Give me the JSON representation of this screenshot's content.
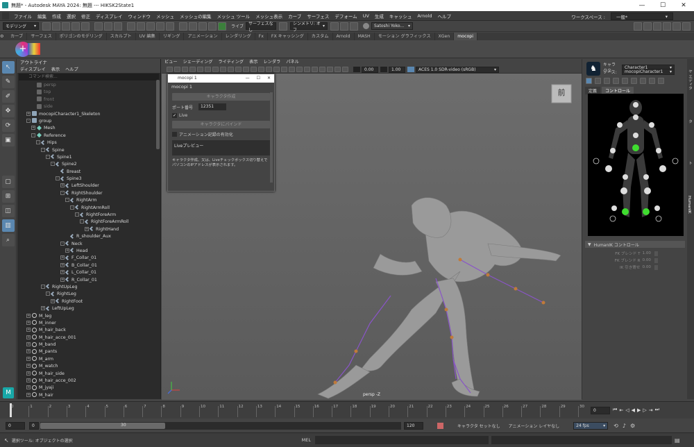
{
  "window": {
    "title": "無題* - Autodesk MAYA 2024: 無題   ---   HIKSK2State1",
    "min": "—",
    "max": "☐",
    "close": "✕"
  },
  "menu": [
    "ファイル",
    "編集",
    "作成",
    "選択",
    "修正",
    "ディスプレイ",
    "ウィンドウ",
    "メッシュ",
    "メッシュの編集",
    "メッシュ ツール",
    "メッシュ表示",
    "カーブ",
    "サーフェス",
    "デフォーム",
    "UV",
    "生成",
    "キャッシュ",
    "Arnold",
    "ヘルプ"
  ],
  "workspace": {
    "label": "ワークスペース :",
    "value": "一般*"
  },
  "status": {
    "mode": "モデリング",
    "symmetry_prefix": "ライブ",
    "live_surface": "サーフェスなし",
    "symmetry": "シンメトリ: オフ",
    "user": "Satoshi Yoko..."
  },
  "shelf_tabs": [
    "カーブ",
    "サーフェス",
    "ポリゴンのモデリング",
    "スカルプト",
    "UV 編集",
    "リギング",
    "アニメーション",
    "レンダリング",
    "Fx",
    "FX キャッシング",
    "カスタム",
    "Arnold",
    "MASH",
    "モーション グラフィックス",
    "XGen",
    "mocopi"
  ],
  "shelf_active": "mocopi",
  "outliner": {
    "title": "アウトライナ",
    "menu": [
      "ディスプレイ",
      "表示",
      "ヘルプ"
    ],
    "search_placeholder": "コマンド検索...",
    "rows": [
      {
        "d": 2,
        "t": "persp",
        "i": "cam",
        "dim": true
      },
      {
        "d": 2,
        "t": "top",
        "i": "cam",
        "dim": true
      },
      {
        "d": 2,
        "t": "front",
        "i": "cam",
        "dim": true
      },
      {
        "d": 2,
        "t": "side",
        "i": "cam",
        "dim": true
      },
      {
        "d": 1,
        "t": "mocopiCharacter1_Skeleton",
        "i": "grp",
        "e": "+"
      },
      {
        "d": 1,
        "t": "group",
        "i": "grp",
        "e": "-"
      },
      {
        "d": 2,
        "t": "Mesh",
        "i": "mesh",
        "e": "+"
      },
      {
        "d": 2,
        "t": "Reference",
        "i": "mesh",
        "e": "-"
      },
      {
        "d": 3,
        "t": "Hips",
        "i": "joint",
        "e": "-"
      },
      {
        "d": 4,
        "t": "Spine",
        "i": "joint",
        "e": "-"
      },
      {
        "d": 5,
        "t": "Spine1",
        "i": "joint",
        "e": "-"
      },
      {
        "d": 6,
        "t": "Spine2",
        "i": "joint",
        "e": "-"
      },
      {
        "d": 7,
        "t": "Breast",
        "i": "joint"
      },
      {
        "d": 7,
        "t": "Spine3",
        "i": "joint",
        "e": "-"
      },
      {
        "d": 8,
        "t": "LeftShoulder",
        "i": "joint",
        "e": "+"
      },
      {
        "d": 8,
        "t": "RightShoulder",
        "i": "joint",
        "e": "-"
      },
      {
        "d": 9,
        "t": "RightArm",
        "i": "joint",
        "e": "-"
      },
      {
        "d": 10,
        "t": "RightArmRoll",
        "i": "joint",
        "e": "-"
      },
      {
        "d": 11,
        "t": "RightForeArm",
        "i": "joint",
        "e": "-"
      },
      {
        "d": 12,
        "t": "RightForeArmRoll",
        "i": "joint",
        "e": "-"
      },
      {
        "d": 13,
        "t": "RightHand",
        "i": "joint",
        "e": "+"
      },
      {
        "d": 9,
        "t": "R_shoulder_Aux",
        "i": "joint"
      },
      {
        "d": 8,
        "t": "Neck",
        "i": "joint",
        "e": "-"
      },
      {
        "d": 9,
        "t": "Head",
        "i": "joint",
        "e": "+"
      },
      {
        "d": 8,
        "t": "F_Collar_01",
        "i": "joint",
        "e": "+"
      },
      {
        "d": 8,
        "t": "B_Collar_01",
        "i": "joint",
        "e": "+"
      },
      {
        "d": 8,
        "t": "L_Collar_01",
        "i": "joint",
        "e": "+"
      },
      {
        "d": 8,
        "t": "R_Collar_01",
        "i": "joint",
        "e": "+"
      },
      {
        "d": 4,
        "t": "RightUpLeg",
        "i": "joint",
        "e": "-"
      },
      {
        "d": 5,
        "t": "RightLeg",
        "i": "joint",
        "e": "-"
      },
      {
        "d": 6,
        "t": "RightFoot",
        "i": "joint",
        "e": "+"
      },
      {
        "d": 4,
        "t": "LeftUpLeg",
        "i": "joint",
        "e": "+"
      },
      {
        "d": 1,
        "t": "M_leg",
        "i": "loc",
        "e": "+"
      },
      {
        "d": 1,
        "t": "M_inner",
        "i": "loc",
        "e": "+"
      },
      {
        "d": 1,
        "t": "M_hair_back",
        "i": "loc",
        "e": "+"
      },
      {
        "d": 1,
        "t": "M_hair_acce_001",
        "i": "loc",
        "e": "+"
      },
      {
        "d": 1,
        "t": "M_band",
        "i": "loc",
        "e": "+"
      },
      {
        "d": 1,
        "t": "M_pants",
        "i": "loc",
        "e": "+"
      },
      {
        "d": 1,
        "t": "M_arm",
        "i": "loc",
        "e": "+"
      },
      {
        "d": 1,
        "t": "M_watch",
        "i": "loc",
        "e": "+"
      },
      {
        "d": 1,
        "t": "M_hair_side",
        "i": "loc",
        "e": "+"
      },
      {
        "d": 1,
        "t": "M_hair_acce_002",
        "i": "loc",
        "e": "+"
      },
      {
        "d": 1,
        "t": "M_jyaji",
        "i": "loc",
        "e": "+"
      },
      {
        "d": 1,
        "t": "M_hair",
        "i": "loc",
        "e": "+"
      }
    ]
  },
  "viewport": {
    "menu": [
      "ビュー",
      "シェーディング",
      "ライティング",
      "表示",
      "レンダラ",
      "パネル"
    ],
    "exposure": "0.00",
    "gamma": "1.00",
    "colorspace": "ACES 1.0 SDR-video (sRGB)",
    "camera_label": "persp -Z",
    "view_cube": "前"
  },
  "dialog": {
    "title": "mocopi 1",
    "heading": "mocopi 1",
    "create_char": "キャラクタ作成",
    "port_label": "ポート番号",
    "port": "12351",
    "live": "Live",
    "bind": "キャラクタにバインド",
    "anim_record": "アニメーション記録の有効化",
    "preview": "Liveプレビュー",
    "note": "キャラクタ作成、又は、Liveチェックボックス切り替えでパソコンのIPアドレスが表示されます。"
  },
  "hik": {
    "character_label": "キャラクタ:",
    "character": "Character1",
    "source_label": "ソース:",
    "source": "mocopiCharacter1",
    "tabs": [
      "定義",
      "コントロール"
    ],
    "active_tab": "コントロール",
    "section": "HumanIK コントロール",
    "params": [
      {
        "label": "FK ブレンド T",
        "value": "1.00"
      },
      {
        "label": "FK ブレンド R",
        "value": "0.00"
      },
      {
        "label": "IK 引き寄せ",
        "value": "0.00"
      }
    ]
  },
  "side_tabs": [
    "チャネル ボックス/レイヤ エディタ",
    "アトリビュート エディタ",
    "モデリング ツールキット",
    "HumanIK"
  ],
  "timeline": {
    "ticks": [
      "0",
      "1",
      "2",
      "3",
      "4",
      "5",
      "6",
      "7",
      "8",
      "9",
      "10",
      "11",
      "12",
      "13",
      "14",
      "15",
      "16",
      "17",
      "18",
      "19",
      "20",
      "21",
      "22",
      "23",
      "24",
      "25",
      "26",
      "27",
      "28",
      "29",
      "30"
    ],
    "current": "0",
    "current_marker": "0"
  },
  "range": {
    "start": "0",
    "inner_start": "0",
    "inner_end": "30",
    "end": "120",
    "char_set": "キャラクタ セットなし",
    "anim_layer": "アニメーション レイヤなし",
    "fps": "24 fps"
  },
  "help_line": "選択ツール: オブジェクトの選択",
  "cmd_label": "MEL",
  "colors": {
    "accent": "#5a87b0",
    "green": "#3fdc2f",
    "joint": "#8a55c8"
  }
}
